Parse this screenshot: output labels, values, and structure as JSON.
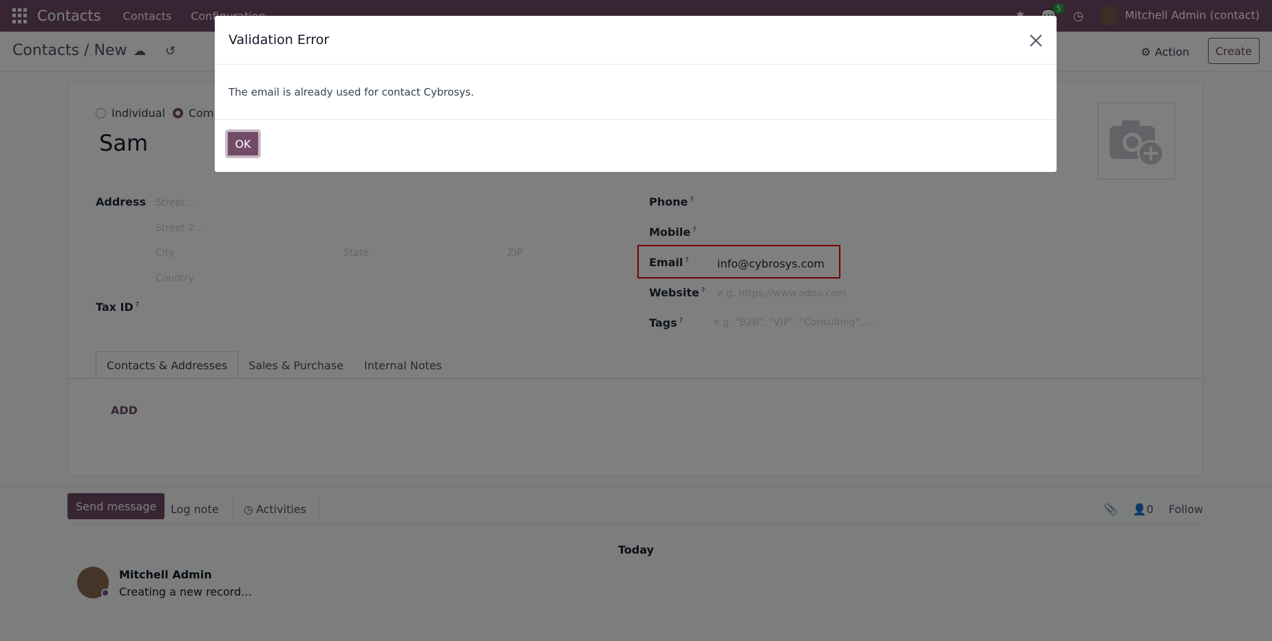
{
  "topbar": {
    "app_name": "Contacts",
    "menu": [
      "Contacts",
      "Configuration"
    ],
    "messages_count": "5",
    "user_name": "Mitchell Admin (contact)"
  },
  "controlbar": {
    "breadcrumb": "Contacts / New",
    "action_label": "Action",
    "create_label": "Create"
  },
  "form": {
    "company_type": {
      "individual": "Individual",
      "company": "Comp",
      "selected": "company"
    },
    "name_value": "Sam",
    "address_label": "Address",
    "street_placeholder": "Street...",
    "street2_placeholder": "Street 2...",
    "city_placeholder": "City",
    "state_placeholder": "State",
    "zip_placeholder": "ZIP",
    "country_placeholder": "Country",
    "taxid_label": "Tax ID",
    "phone_label": "Phone",
    "mobile_label": "Mobile",
    "email_label": "Email",
    "email_value": "info@cybrosys.com",
    "website_label": "Website",
    "website_placeholder": "e.g. https://www.odoo.com",
    "tags_label": "Tags",
    "tags_placeholder": "e.g. \"B2B\", \"VIP\", \"Consulting\", ...",
    "help_mark": "?"
  },
  "tabs": [
    "Contacts & Addresses",
    "Sales & Purchase",
    "Internal Notes"
  ],
  "add_label": "ADD",
  "chatter": {
    "send_message": "Send message",
    "log_note": "Log note",
    "activities": "Activities",
    "followers_count": "0",
    "follow": "Follow",
    "today": "Today",
    "message_author": "Mitchell Admin",
    "message_body": "Creating a new record..."
  },
  "dialog": {
    "title": "Validation Error",
    "message": "The email is already used for contact Cybrosys.",
    "ok_label": "OK"
  },
  "colors": {
    "brand": "#714B67",
    "highlight": "#ee0000"
  }
}
